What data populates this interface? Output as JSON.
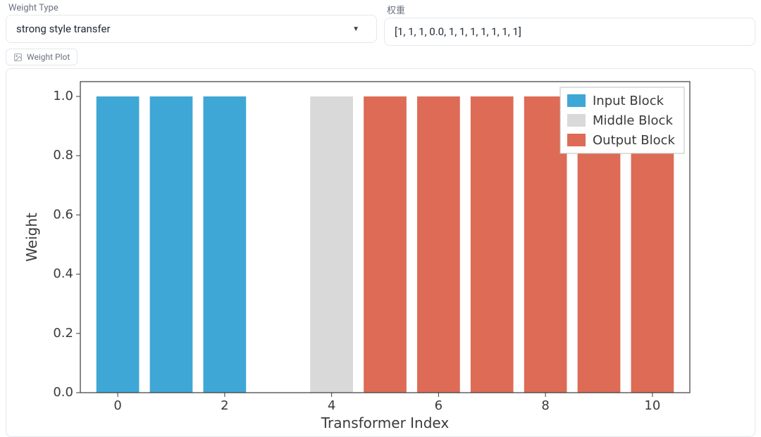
{
  "controls": {
    "weight_type_label": "Weight Type",
    "weight_type_value": "strong style transfer",
    "weights_label": "权重",
    "weights_value": "[1, 1, 1, 0.0, 1, 1, 1, 1, 1, 1, 1]"
  },
  "tab": {
    "label": "Weight Plot"
  },
  "chart_data": {
    "type": "bar",
    "categories": [
      0,
      1,
      2,
      3,
      4,
      5,
      6,
      7,
      8,
      9,
      10
    ],
    "series": [
      {
        "name": "Input Block",
        "indices": [
          0,
          1,
          2
        ],
        "values": [
          1,
          1,
          1
        ],
        "color": "#3fa7d6"
      },
      {
        "name": "Middle Block",
        "indices": [
          3,
          4
        ],
        "values": [
          0.0,
          1
        ],
        "color": "#d9d9d9"
      },
      {
        "name": "Output Block",
        "indices": [
          5,
          6,
          7,
          8,
          9,
          10
        ],
        "values": [
          1,
          1,
          1,
          1,
          1,
          1
        ],
        "color": "#dd6b56"
      }
    ],
    "xlabel": "Transformer Index",
    "ylabel": "Weight",
    "xlim": [
      -0.7,
      10.7
    ],
    "ylim": [
      0.0,
      1.05
    ],
    "y_ticks": [
      0.0,
      0.2,
      0.4,
      0.6,
      0.8,
      1.0
    ],
    "x_ticks": [
      0,
      2,
      4,
      6,
      8,
      10
    ],
    "legend_entries": [
      "Input Block",
      "Middle Block",
      "Output Block"
    ],
    "legend_position": "upper right",
    "bar_width": 0.8,
    "colors": {
      "input": "#3fa7d6",
      "middle": "#d9d9d9",
      "output": "#dd6b56",
      "spine": "#3a3a3a",
      "tick": "#3a3a3a",
      "text": "#3a3a3a"
    }
  }
}
